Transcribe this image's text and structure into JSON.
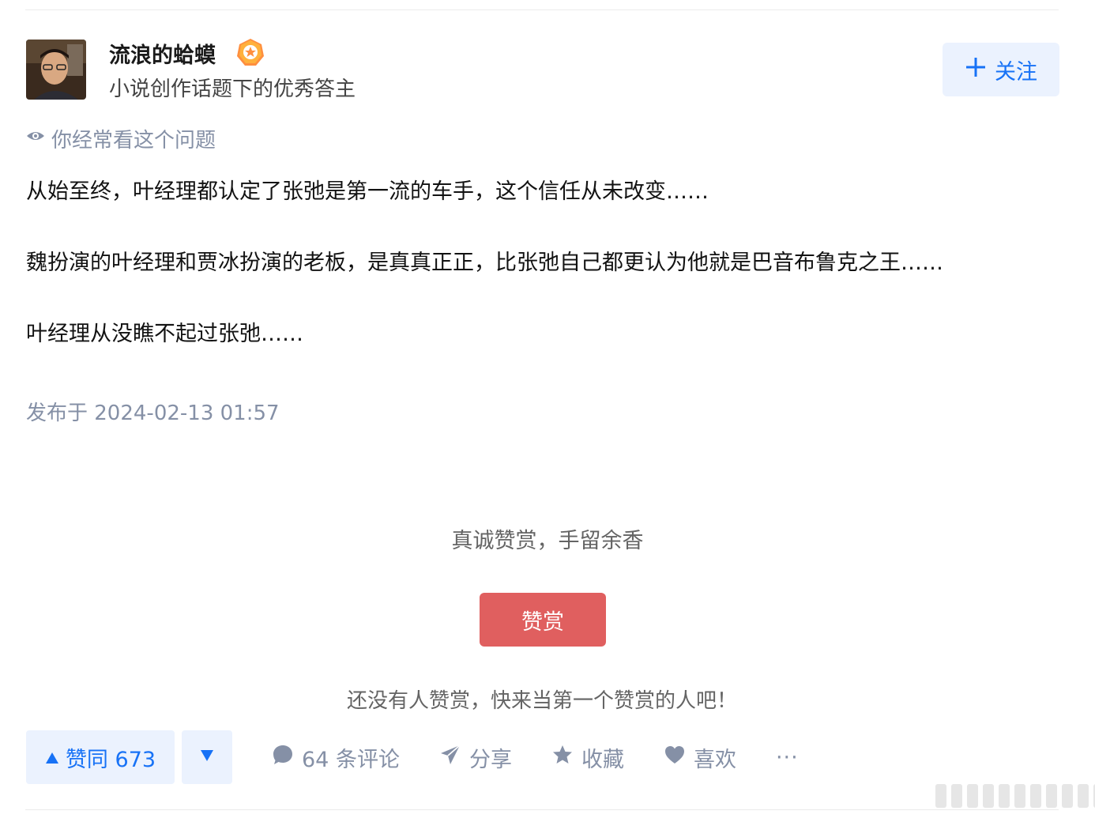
{
  "author": {
    "name": "流浪的蛤蟆",
    "headline": "小说创作话题下的优秀答主"
  },
  "follow": {
    "plus": "+",
    "label": "关注"
  },
  "seen_hint": "你经常看这个问题",
  "content": {
    "paragraphs": [
      "从始至终，叶经理都认定了张弛是第一流的车手，这个信任从未改变……",
      "魏扮演的叶经理和贾冰扮演的老板，是真真正正，比张弛自己都更认为他就是巴音布鲁克之王……",
      "叶经理从没瞧不起过张弛……"
    ]
  },
  "publish_time": "发布于 2024-02-13 01:57",
  "reward": {
    "slogan": "真诚赞赏，手留余香",
    "button_label": "赞赏",
    "hint": "还没有人赞赏，快来当第一个赞赏的人吧！"
  },
  "actions": {
    "vote_up_label": "赞同 673",
    "comments_label": "64 条评论",
    "share_label": "分享",
    "favorite_label": "收藏",
    "like_label": "喜欢",
    "more_label": "···"
  },
  "colors": {
    "accent": "#1772f6",
    "reward": "#e05f5f",
    "muted": "#8590a6"
  },
  "icons": [
    "plus-icon",
    "eye-icon",
    "triangle-up-icon",
    "triangle-down-icon",
    "comment-icon",
    "paper-plane-icon",
    "star-icon",
    "heart-icon",
    "more-icon"
  ]
}
